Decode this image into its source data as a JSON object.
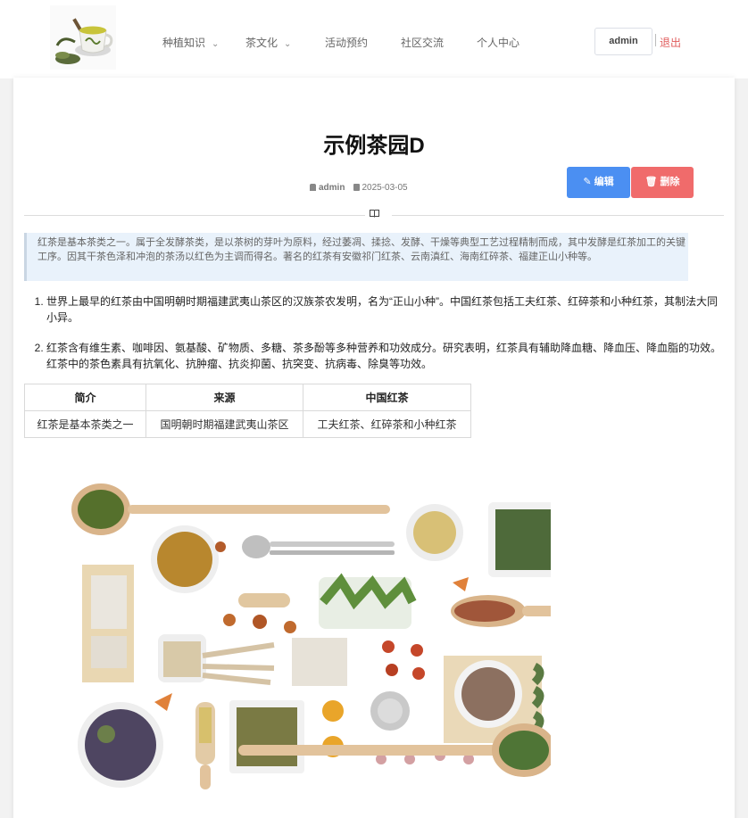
{
  "header": {
    "logo": "tea-cup-logo",
    "nav": [
      {
        "label": "种植知识",
        "has_dropdown": true
      },
      {
        "label": "茶文化",
        "has_dropdown": true
      },
      {
        "label": "活动预约",
        "has_dropdown": false
      },
      {
        "label": "社区交流",
        "has_dropdown": false
      },
      {
        "label": "个人中心",
        "has_dropdown": false
      }
    ],
    "user": "admin",
    "logout": "退出"
  },
  "article": {
    "title": "示例茶园D",
    "author": "admin",
    "date": "2025-03-05",
    "edit_label": "编辑",
    "delete_label": "删除",
    "quote": "红茶是基本茶类之一。属于全发酵茶类，是以茶树的芽叶为原料，经过萎凋、揉捻、发酵、干燥等典型工艺过程精制而成，其中发酵是红茶加工的关键工序。因其干茶色泽和冲泡的茶汤以红色为主调而得名。著名的红茶有安徽祁门红茶、云南滇红、海南红碎茶、福建正山小种等。",
    "list": [
      "世界上最早的红茶由中国明朝时期福建武夷山茶区的汉族茶农发明，名为“正山小种”。中国红茶包括工夫红茶、红碎茶和小种红茶，其制法大同小异。",
      "红茶含有维生素、咖啡因、氨基酸、矿物质、多糖、茶多酚等多种营养和功效成分。研究表明，红茶具有辅助降血糖、降血压、降血脂的功效。红茶中的茶色素具有抗氧化、抗肿瘤、抗炎抑菌、抗突变、抗病毒、除臭等功效。"
    ],
    "table": {
      "headers": [
        "简介",
        "来源",
        "中国红茶"
      ],
      "rows": [
        [
          "红茶是基本茶类之一",
          "国明朝时期福建武夷山茶区",
          "工夫红茶、红碎茶和小种红茶"
        ]
      ]
    },
    "image": "herbs-and-tea-flatlay"
  },
  "colors": {
    "primary": "#4b8ff2",
    "danger": "#f06b6b",
    "logout": "#e05c5c",
    "quote_bg": "#e9f2fb"
  }
}
